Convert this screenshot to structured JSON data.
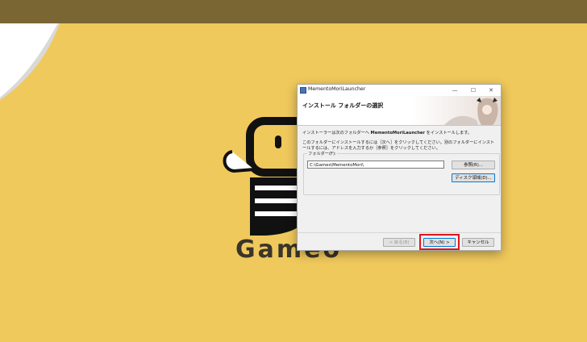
{
  "installer": {
    "window_title": "MementoMoriLauncher",
    "window_controls": {
      "minimize": "—",
      "maximize": "☐",
      "close": "✕"
    },
    "header_title": "インストール フォルダーの選択",
    "intro_prefix": "インストーラーは次のフォルダーへ ",
    "app_name": "MementoMoriLauncher",
    "intro_suffix": " をインストールします。",
    "instructions": "このフォルダーにインストールするには［次へ］をクリックしてください。別のフォルダーにインストールするには、アドレスを入力するか［参照］をクリックしてください。",
    "folder_label": "フォルダー(F):",
    "folder_value": "C:\\Games\\MementoMori\\",
    "browse_label": "参照(R)...",
    "disk_space_label": "ディスク領域(D)...",
    "back_label": "< 戻る(B)",
    "next_label": "次へ(N) >",
    "cancel_label": "キャンセル"
  },
  "background": {
    "logo_text": "Gameo"
  },
  "colors": {
    "background": "#f0c95c",
    "top_bar": "#7a6632",
    "highlight": "#e0161c",
    "focus_border": "#0078d7"
  }
}
